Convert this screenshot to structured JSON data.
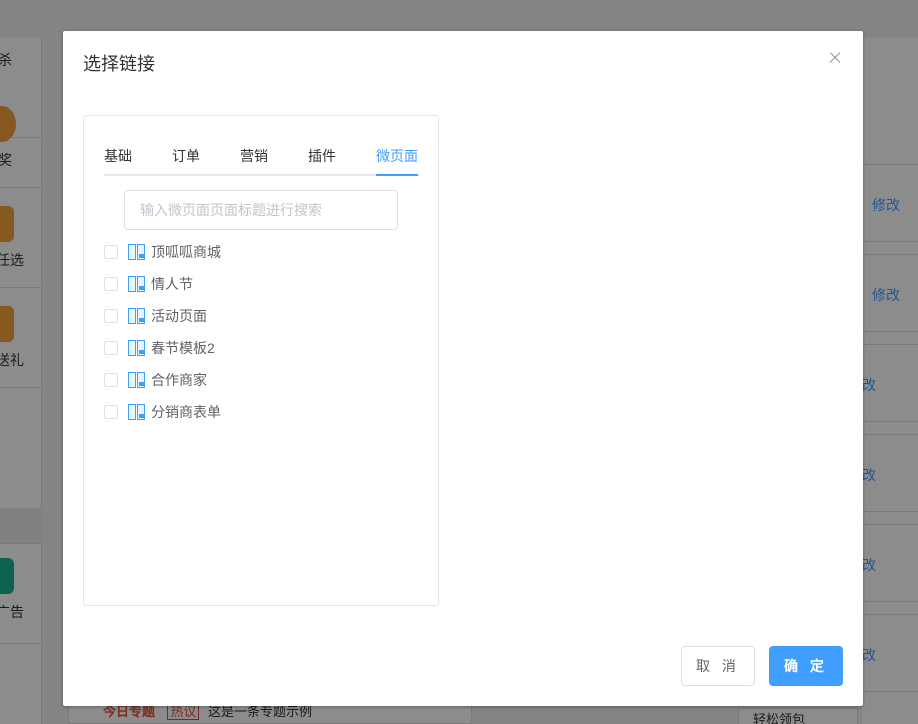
{
  "background": {
    "left_labels": [
      "杀",
      "奖",
      "任选",
      "送礼",
      "广告"
    ],
    "right_edit_labels": [
      "修改",
      "修改",
      "改",
      "改",
      "改",
      "改"
    ],
    "bottom_tags": [
      "今日专题",
      "热议"
    ],
    "bottom_text": "这是一条专题示例",
    "bottom_right_text": "轻松领包"
  },
  "dialog": {
    "title": "选择链接",
    "tabs": [
      {
        "label": "基础",
        "active": false
      },
      {
        "label": "订单",
        "active": false
      },
      {
        "label": "营销",
        "active": false
      },
      {
        "label": "插件",
        "active": false
      },
      {
        "label": "微页面",
        "active": true
      }
    ],
    "search": {
      "placeholder": "输入微页面页面标题进行搜索",
      "value": ""
    },
    "pages": [
      {
        "label": "顶呱呱商城",
        "checked": false
      },
      {
        "label": "情人节",
        "checked": false
      },
      {
        "label": "活动页面",
        "checked": false
      },
      {
        "label": "春节模板2",
        "checked": false
      },
      {
        "label": "合作商家",
        "checked": false
      },
      {
        "label": "分销商表单",
        "checked": false
      }
    ],
    "buttons": {
      "cancel": "取 消",
      "confirm": "确 定"
    }
  },
  "colors": {
    "accent": "#409eff",
    "overlay": "rgba(0,0,0,0.45)"
  },
  "icons": {
    "close": "close-icon",
    "page": "page-icon",
    "checkbox": "checkbox-icon"
  }
}
